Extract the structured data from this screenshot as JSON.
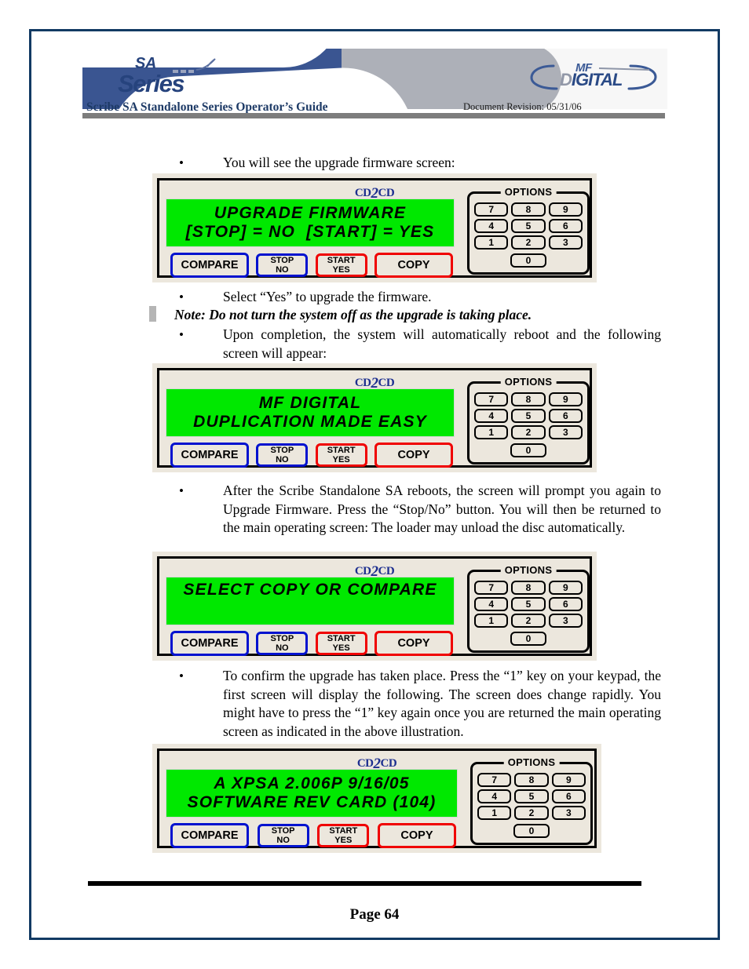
{
  "header": {
    "logo_sa_line1": "SA",
    "logo_sa_line2": "Series",
    "logo_mf_line1": "MF",
    "logo_mf_line2_d": "D",
    "logo_mf_line2_rest": "IGITAL",
    "guide_title": "Scribe SA Standalone Series Operator’s Guide",
    "doc_revision": "Document Revision: 05/31/06"
  },
  "body": {
    "bullet1": "You will see the upgrade firmware screen:",
    "bullet2": "Select “Yes” to upgrade the firmware.",
    "note": "Note: Do not turn the system off as the upgrade is taking place.",
    "bullet3": "Upon completion, the system will automatically reboot and the following screen will appear:",
    "bullet4": "After the Scribe Standalone SA reboots, the screen will prompt you again to Upgrade Firmware.  Press the “Stop/No” button.  You will then be returned to the main operating screen:  The loader may unload the disc automatically.",
    "bullet5": "To confirm the upgrade has taken place.  Press the “1” key on your keypad, the first screen will display the following.  The screen does change rapidly.  You might have to press the “1” key again once you are returned the main operating screen as indicated in the above illustration.",
    "bullet_glyph": "•"
  },
  "panel_common": {
    "brand_cd": "CD",
    "brand_two": "2",
    "brand_cd2": "CD",
    "options_label": "OPTIONS",
    "keys": [
      "7",
      "8",
      "9",
      "4",
      "5",
      "6",
      "1",
      "2",
      "3"
    ],
    "key_zero": "0",
    "buttons": {
      "compare": "COMPARE",
      "stop_l1": "STOP",
      "stop_l2": "NO",
      "start_l1": "START",
      "start_l2": "YES",
      "copy": "COPY"
    },
    "colors": {
      "lcd_green": "#00e800",
      "panel_beige": "#ece7dd",
      "blue_border": "#0012cf",
      "red_border": "#f00000",
      "brand_blue": "#1d2f8f"
    }
  },
  "panels": [
    {
      "id": "upgrade-firmware",
      "lcd_lines": [
        "UPGRADE FIRMWARE",
        "[STOP] = NO  [START] = YES"
      ]
    },
    {
      "id": "mf-digital-splash",
      "lcd_lines": [
        "MF DIGITAL",
        "DUPLICATION MADE EASY"
      ]
    },
    {
      "id": "select-copy-or-compare",
      "lcd_lines": [
        "SELECT COPY OR COMPARE",
        ""
      ]
    },
    {
      "id": "software-rev",
      "lcd_lines": [
        "A XPSA 2.006P 9/16/05",
        "SOFTWARE REV CARD (104)"
      ]
    }
  ],
  "footer": {
    "page_label": "Page 64"
  }
}
